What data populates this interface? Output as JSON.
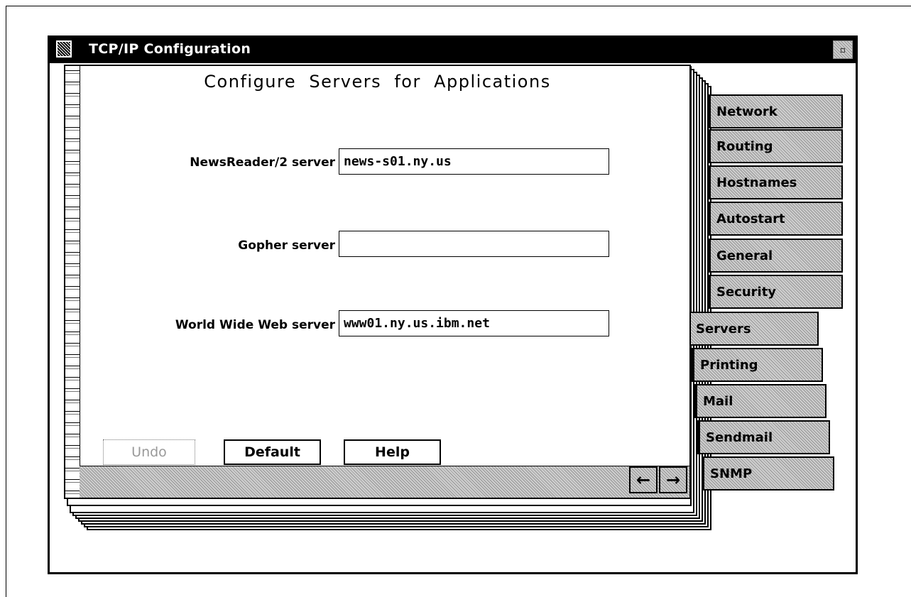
{
  "window": {
    "title": "TCP/IP Configuration"
  },
  "page": {
    "title": "Configure  Servers  for  Applications"
  },
  "fields": {
    "newsreader": {
      "label": "NewsReader/2 server",
      "value": "news-s01.ny.us"
    },
    "gopher": {
      "label": "Gopher server",
      "value": ""
    },
    "www": {
      "label": "World Wide Web server",
      "value": "www01.ny.us.ibm.net"
    }
  },
  "buttons": {
    "undo": "Undo",
    "default": "Default",
    "help": "Help",
    "prev": "←",
    "next": "→"
  },
  "tabs": {
    "major": [
      "Network",
      "Routing",
      "Hostnames",
      "Autostart",
      "General",
      "Security"
    ],
    "selected": "Servers",
    "minor": [
      "Printing",
      "Mail",
      "Sendmail",
      "SNMP"
    ]
  },
  "icons": {
    "system_menu": "system-menu-icon",
    "minimize": "minimize-icon"
  }
}
